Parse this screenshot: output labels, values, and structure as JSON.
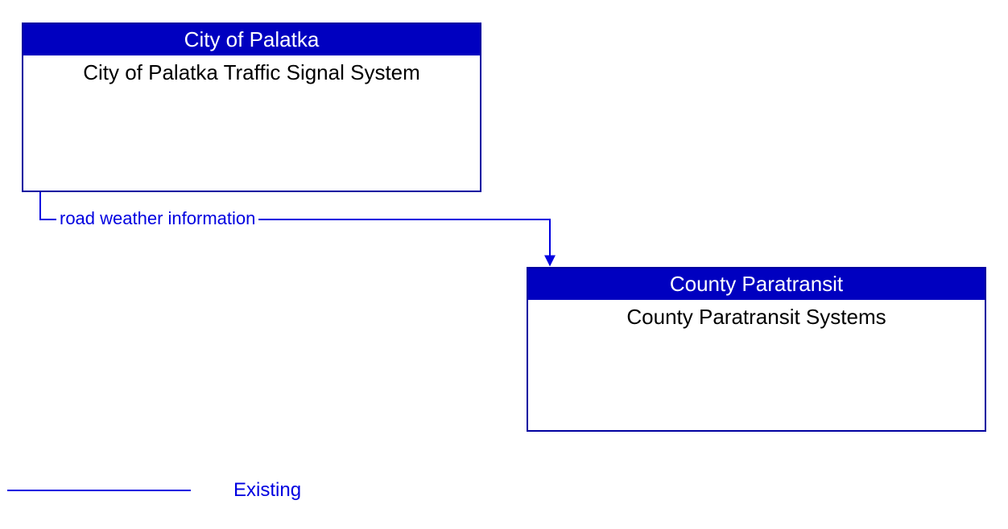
{
  "nodes": {
    "source": {
      "header": "City of Palatka",
      "body": "City of Palatka Traffic Signal System"
    },
    "target": {
      "header": "County Paratransit",
      "body": "County Paratransit Systems"
    }
  },
  "flows": {
    "road_weather": "road weather information"
  },
  "legend": {
    "existing": "Existing"
  },
  "colors": {
    "headerFill": "#0000c0",
    "border": "#0000a0",
    "line": "#0000e0"
  }
}
